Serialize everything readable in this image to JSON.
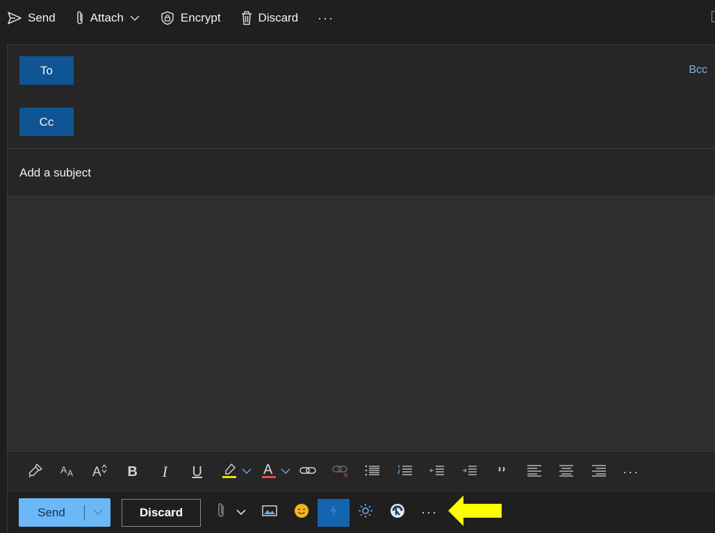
{
  "topbar": {
    "send_label": "Send",
    "attach_label": "Attach",
    "encrypt_label": "Encrypt",
    "discard_label": "Discard",
    "more_label": "···"
  },
  "recipients": {
    "to_label": "To",
    "cc_label": "Cc",
    "bcc_label": "Bcc"
  },
  "subject": {
    "placeholder": "Add a subject",
    "value": ""
  },
  "format_toolbar": {
    "bold": "B",
    "italic": "I",
    "underline": "U",
    "font_color": "A",
    "more_label": "···",
    "icons": [
      "format-painter-icon",
      "font-size-icon",
      "grow-font-icon",
      "bold-icon",
      "italic-icon",
      "underline-icon",
      "highlight-icon",
      "font-color-icon",
      "link-icon",
      "remove-link-icon",
      "bullets-icon",
      "numbering-icon",
      "decrease-indent-icon",
      "increase-indent-icon",
      "quote-icon",
      "align-left-icon",
      "align-center-icon",
      "align-right-icon",
      "more-options-icon"
    ]
  },
  "actions": {
    "send_label": "Send",
    "discard_label": "Discard",
    "more_label": "···",
    "icons": [
      "attach-icon",
      "chevron-down-icon",
      "insert-picture-icon",
      "emoji-icon",
      "editor-icon",
      "sensitivity-icon",
      "app-add-in-icon",
      "more-options-icon",
      "yellow-arrow-icon"
    ]
  },
  "colors": {
    "accent": "#0f5593",
    "send_button": "#6cb8f6",
    "link": "#7ab5ec",
    "highlight": "#f2e20b",
    "font_color_bar": "#e8484e",
    "annotation_arrow": "#ffff00"
  }
}
